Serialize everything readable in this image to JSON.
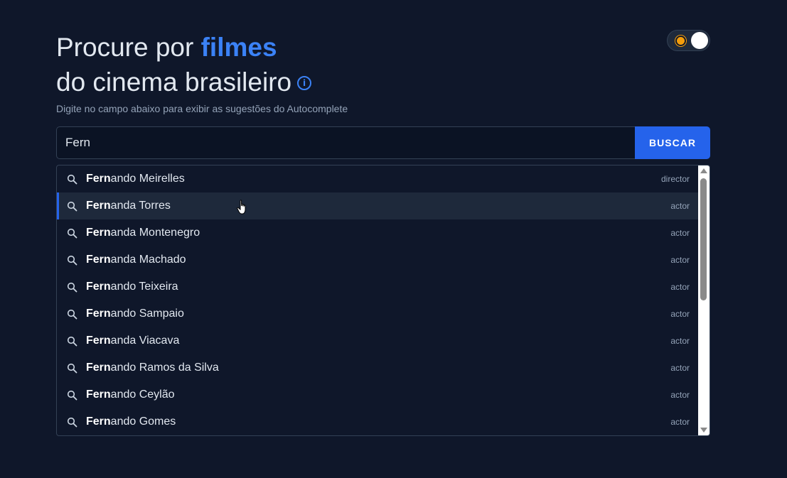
{
  "header": {
    "title_part1": "Procure por ",
    "title_accent": "filmes",
    "title_line2": "do cinema brasileiro",
    "info_glyph": "i",
    "subtitle": "Digite no campo abaixo para exibir as sugestões do Autocomplete"
  },
  "theme_toggle": {
    "state": "dark",
    "icon": "sun-icon"
  },
  "search": {
    "value": "Fern",
    "button_label": "BUSCAR"
  },
  "suggestions": [
    {
      "match": "Fern",
      "rest": "ando Meirelles",
      "role": "director",
      "active": false
    },
    {
      "match": "Fern",
      "rest": "anda Torres",
      "role": "actor",
      "active": true
    },
    {
      "match": "Fern",
      "rest": "anda Montenegro",
      "role": "actor",
      "active": false
    },
    {
      "match": "Fern",
      "rest": "anda Machado",
      "role": "actor",
      "active": false
    },
    {
      "match": "Fern",
      "rest": "ando Teixeira",
      "role": "actor",
      "active": false
    },
    {
      "match": "Fern",
      "rest": "ando Sampaio",
      "role": "actor",
      "active": false
    },
    {
      "match": "Fern",
      "rest": "anda Viacava",
      "role": "actor",
      "active": false
    },
    {
      "match": "Fern",
      "rest": "ando Ramos da Silva",
      "role": "actor",
      "active": false
    },
    {
      "match": "Fern",
      "rest": "ando Ceylão",
      "role": "actor",
      "active": false
    },
    {
      "match": "Fern",
      "rest": "ando Gomes",
      "role": "actor",
      "active": false
    }
  ],
  "colors": {
    "background": "#0f172a",
    "accent": "#3b82f6",
    "button": "#2563eb"
  }
}
